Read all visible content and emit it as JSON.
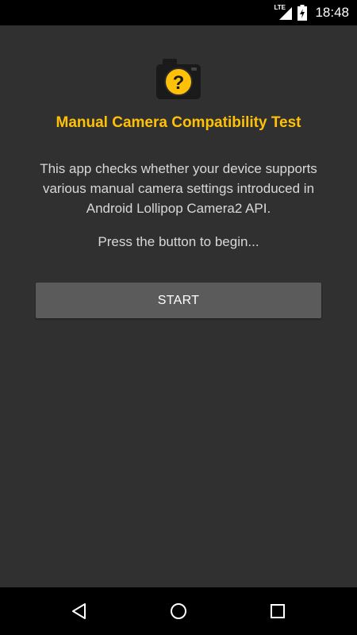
{
  "status_bar": {
    "network_label": "LTE",
    "time": "18:48",
    "icons": [
      "signal-icon",
      "battery-charging-icon"
    ]
  },
  "app": {
    "icon": "camera-question-icon",
    "title": "Manual Camera Compatibility Test",
    "description": "This app checks whether your device supports various manual camera settings introduced in Android Lollipop Camera2 API.",
    "prompt": "Press the button to begin...",
    "start_button_label": "START",
    "accent_color": "#ffc107"
  },
  "nav_bar": {
    "icons": [
      "back-icon",
      "home-icon",
      "recents-icon"
    ]
  }
}
